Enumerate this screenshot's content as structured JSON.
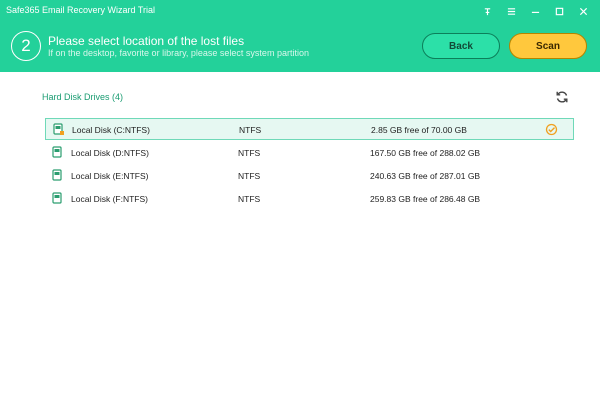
{
  "window": {
    "title": "Safe365 Email Recovery Wizard Trial",
    "controls": [
      "pin-icon",
      "menu-icon",
      "minimize-icon",
      "maximize-icon",
      "close-icon"
    ]
  },
  "step": {
    "number": "2",
    "title": "Please select location of the lost files",
    "subtitle": "If on the desktop, favorite or library, please select system partition"
  },
  "buttons": {
    "back": "Back",
    "scan": "Scan"
  },
  "section": {
    "title": "Hard Disk Drives (4)"
  },
  "drives": [
    {
      "name": "Local Disk (C:NTFS)",
      "fs": "NTFS",
      "free": "2.85 GB free of 70.00 GB",
      "selected": true
    },
    {
      "name": "Local Disk (D:NTFS)",
      "fs": "NTFS",
      "free": "167.50 GB free of 288.02 GB",
      "selected": false
    },
    {
      "name": "Local Disk (E:NTFS)",
      "fs": "NTFS",
      "free": "240.63 GB free of 287.01 GB",
      "selected": false
    },
    {
      "name": "Local Disk (F:NTFS)",
      "fs": "NTFS",
      "free": "259.83 GB free of 286.48 GB",
      "selected": false
    }
  ],
  "colors": {
    "header": "#23d19a",
    "accent_text": "#1a9c72",
    "scan_button": "#ffc83d",
    "back_button": "#2ce0a8",
    "selected_row": "#e6f8f2"
  }
}
